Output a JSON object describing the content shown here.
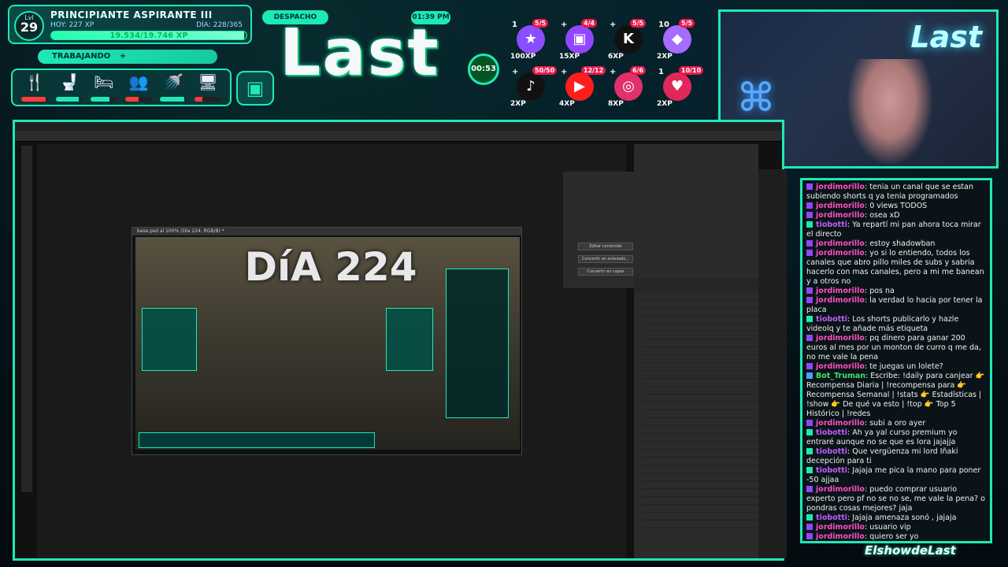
{
  "profile": {
    "level_label": "Lvl",
    "level": "29",
    "rank": "PRINCIPIANTE ASPIRANTE III",
    "today_xp": "HOY: 227 XP",
    "day_progress": "DÍA: 228/365",
    "xp_text": "19.534/19.746 XP",
    "xp_fraction": 0.989
  },
  "status": {
    "working": "TRABAJANDO",
    "plus": "+"
  },
  "needs": [
    {
      "icon": "fork-knife-icon",
      "glyph": "🍴",
      "level": 0.9,
      "color": "#ff3b3b"
    },
    {
      "icon": "toilet-icon",
      "glyph": "🚽",
      "level": 0.85,
      "color": "#1de9b6"
    },
    {
      "icon": "bed-icon",
      "glyph": "🛏",
      "level": 0.7,
      "color": "#1de9b6"
    },
    {
      "icon": "people-icon",
      "glyph": "👥",
      "level": 0.5,
      "color": "#ff3b3b"
    },
    {
      "icon": "shower-icon",
      "glyph": "🚿",
      "level": 0.9,
      "color": "#1de9b6"
    },
    {
      "icon": "computer-icon",
      "glyph": "🖥",
      "level": 0.3,
      "color": "#ff3b3b"
    }
  ],
  "center": {
    "location": "DESPACHO",
    "logo": "Last",
    "time": "01:39 PM",
    "timer": "00:53"
  },
  "socials": [
    {
      "icon": "star-icon",
      "glyph": "★",
      "color": "#8a4dff",
      "count": "5/5",
      "xp": "100XP",
      "plus": "1"
    },
    {
      "icon": "twitch-icon",
      "glyph": "▣",
      "color": "#9146ff",
      "count": "4/4",
      "xp": "15XP",
      "plus": "+"
    },
    {
      "icon": "kick-icon",
      "glyph": "K",
      "color": "#111",
      "count": "5/5",
      "xp": "6XP",
      "plus": "+"
    },
    {
      "icon": "crystal-icon",
      "glyph": "◆",
      "color": "#a66bff",
      "count": "5/5",
      "xp": "2XP",
      "plus": "10"
    },
    {
      "icon": "tiktok-icon",
      "glyph": "♪",
      "color": "#111",
      "count": "50/50",
      "xp": "2XP",
      "plus": "+"
    },
    {
      "icon": "youtube-icon",
      "glyph": "▶",
      "color": "#ff1e1e",
      "count": "12/12",
      "xp": "4XP",
      "plus": "+"
    },
    {
      "icon": "instagram-icon",
      "glyph": "◎",
      "color": "#e1306c",
      "count": "6/6",
      "xp": "8XP",
      "plus": "+"
    },
    {
      "icon": "bell-icon",
      "glyph": "♥",
      "color": "#e0285a",
      "count": "10/10",
      "xp": "2XP",
      "plus": "1"
    }
  ],
  "webcam": {
    "brand": "Last",
    "controller_icon": "gamepad-icon"
  },
  "screen": {
    "doc_title": "base.psd al 100% (Día 224, RGB/8) *",
    "canvas_title": "DíA 224",
    "props_buttons": [
      "Editar contenido",
      "Convertir en enlazado...",
      "Convertir en capas"
    ]
  },
  "chat": [
    {
      "badge": "a",
      "user": "jordimorillo",
      "color": "#ff4fc3",
      "text": "tenia un canal que se estan subiendo shorts q ya tenia programados"
    },
    {
      "badge": "a",
      "user": "jordimorillo",
      "color": "#ff4fc3",
      "text": "0 views TODOS"
    },
    {
      "badge": "a",
      "user": "jordimorillo",
      "color": "#ff4fc3",
      "text": "osea xD"
    },
    {
      "badge": "b",
      "user": "tiobotti",
      "color": "#c35bff",
      "text": "Ya repartí mi pan ahora toca mirar el directo"
    },
    {
      "badge": "a",
      "user": "jordimorillo",
      "color": "#ff4fc3",
      "text": "estoy shadowban"
    },
    {
      "badge": "a",
      "user": "jordimorillo",
      "color": "#ff4fc3",
      "text": "yo si lo entiendo, todos los canales que abro pillo miles de subs y sabria hacerlo con mas canales, pero a mi me banean y a otros no"
    },
    {
      "badge": "a",
      "user": "jordimorillo",
      "color": "#ff4fc3",
      "text": "pos na"
    },
    {
      "badge": "a",
      "user": "jordimorillo",
      "color": "#ff4fc3",
      "text": "la verdad lo hacia por tener la placa"
    },
    {
      "badge": "b",
      "user": "tiobotti",
      "color": "#c35bff",
      "text": "Los shorts publicarlo y hazle videolq y te añade más etiqueta"
    },
    {
      "badge": "a",
      "user": "jordimorillo",
      "color": "#ff4fc3",
      "text": "pq dinero para ganar 200 euros al mes por un monton de curro q me da, no me vale la pena"
    },
    {
      "badge": "a",
      "user": "jordimorillo",
      "color": "#ff4fc3",
      "text": "te juegas un lolete?"
    },
    {
      "badge": "c",
      "user": "Bot_Truman",
      "color": "#44e06b",
      "text": "Escribe: !daily para canjear 👉 Recompensa Diaria | !recompensa para 👉 Recompensa Semanal | !stats 👉 Estadísticas | !show 👉 De qué va esto | !top 👉 Top 5 Histórico | !redes"
    },
    {
      "badge": "a",
      "user": "jordimorillo",
      "color": "#ff4fc3",
      "text": "subi a oro ayer"
    },
    {
      "badge": "b",
      "user": "tiobotti",
      "color": "#c35bff",
      "text": "Ah ya yal curso premium yo entraré aunque no se que es lora jajajja"
    },
    {
      "badge": "b",
      "user": "tiobotti",
      "color": "#c35bff",
      "text": "Que vergüenza mi lord Iñaki decepción para ti"
    },
    {
      "badge": "b",
      "user": "tiobotti",
      "color": "#c35bff",
      "text": "Jajaja me pica la mano para poner -50 ajjaa"
    },
    {
      "badge": "a",
      "user": "jordimorillo",
      "color": "#ff4fc3",
      "text": "puedo comprar usuario experto pero pf no se no se, me vale la pena? o pondras cosas mejores? jaja"
    },
    {
      "badge": "b",
      "user": "tiobotti",
      "color": "#c35bff",
      "text": "Jajaja amenaza sonó , jajaja"
    },
    {
      "badge": "a",
      "user": "jordimorillo",
      "color": "#ff4fc3",
      "text": "usuario vip"
    },
    {
      "badge": "a",
      "user": "jordimorillo",
      "color": "#ff4fc3",
      "text": "quiero ser yo"
    }
  ],
  "footer": {
    "brand": "ElshowdeLast"
  }
}
